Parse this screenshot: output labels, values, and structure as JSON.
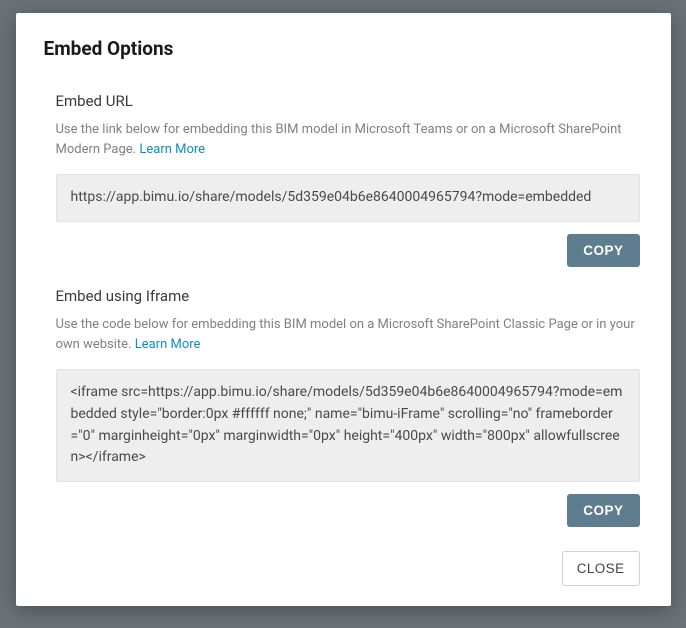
{
  "modal": {
    "title": "Embed Options",
    "close_label": "CLOSE"
  },
  "embed_url": {
    "title": "Embed URL",
    "description": "Use the link below for embedding this BIM model in Microsoft Teams or on a Microsoft SharePoint Modern Page. ",
    "learn_more": "Learn More",
    "value": "https://app.bimu.io/share/models/5d359e04b6e8640004965794?mode=embedded",
    "copy_label": "COPY"
  },
  "embed_iframe": {
    "title": "Embed using Iframe",
    "description": "Use the code below for embedding this BIM model on a Microsoft SharePoint Classic Page or in your own website. ",
    "learn_more": "Learn More",
    "value": "<iframe src=https://app.bimu.io/share/models/5d359e04b6e8640004965794?mode=embedded style=\"border:0px #ffffff none;\" name=\"bimu-iFrame\" scrolling=\"no\" frameborder=\"0\" marginheight=\"0px\" marginwidth=\"0px\" height=\"400px\" width=\"800px\" allowfullscreen></iframe>",
    "copy_label": "COPY"
  }
}
